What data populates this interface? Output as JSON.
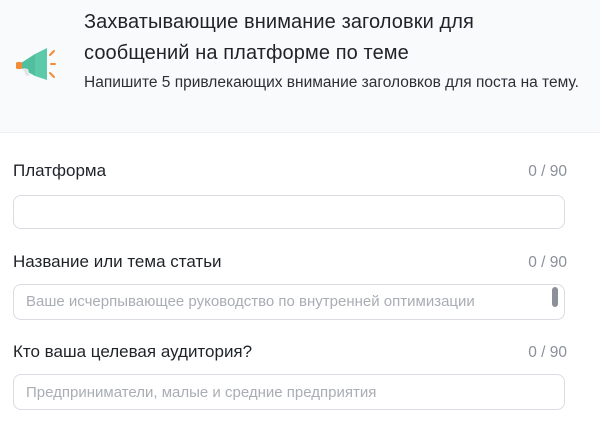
{
  "header": {
    "icon": "megaphone-icon",
    "title": "Захватывающие внимание заголовки для сообщений на платформе по теме",
    "description": "Напишите 5 привлекающих внимание заголовков для поста на тему."
  },
  "fields": [
    {
      "label": "Платформа",
      "counter": "0 / 90",
      "value": "",
      "placeholder": ""
    },
    {
      "label": "Название или тема статьи",
      "counter": "0 / 90",
      "value": "",
      "placeholder": "Ваше исчерпывающее руководство по внутренней оптимизации"
    },
    {
      "label": "Кто ваша целевая аудитория?",
      "counter": "0 / 90",
      "value": "",
      "placeholder": "Предприниматели, малые и средние предприятия"
    }
  ],
  "colors": {
    "accent_green": "#4fbf9f",
    "accent_orange": "#f28c38",
    "text": "#1f2328",
    "muted": "#8a8f98"
  }
}
